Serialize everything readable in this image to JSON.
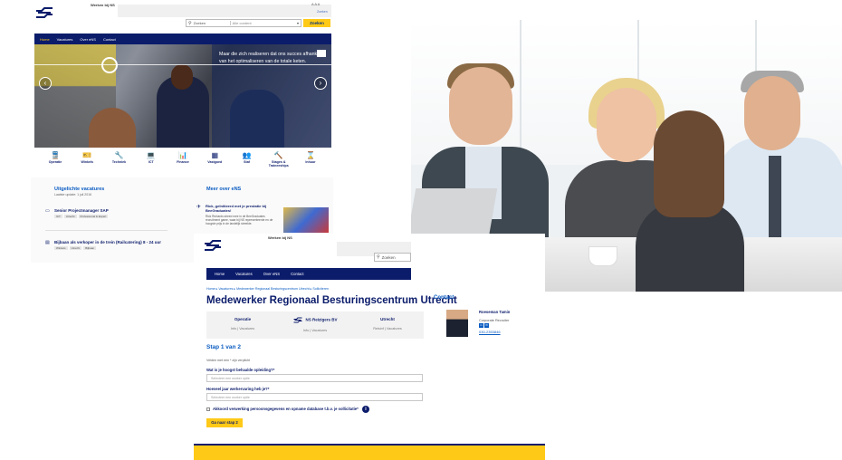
{
  "shot1": {
    "header": {
      "werken_bij": "Werken bij NS",
      "font_sizes": "A A A",
      "zoeken_link": "Zoeken"
    },
    "search": {
      "placeholder": "Zoeken",
      "scope": "Alle content",
      "button": "Zoeken"
    },
    "nav": [
      "Home",
      "Vacatures",
      "Over eNS",
      "Contact"
    ],
    "hero": {
      "quote": "Maar die zich realiseren dat ons succes afhankt van het optimaliseren van de totale keten."
    },
    "categories": [
      {
        "icon": "train-icon",
        "glyph": "🚆",
        "label": "Operatie"
      },
      {
        "icon": "ticket-icon",
        "glyph": "🎫",
        "label": "Winkels"
      },
      {
        "icon": "wrench-icon",
        "glyph": "🔧",
        "label": "Techniek"
      },
      {
        "icon": "laptop-icon",
        "glyph": "💻",
        "label": "ICT"
      },
      {
        "icon": "chart-icon",
        "glyph": "📊",
        "label": "Finance"
      },
      {
        "icon": "boxes-icon",
        "glyph": "▦",
        "label": "Vastgoed"
      },
      {
        "icon": "people-icon",
        "glyph": "👥",
        "label": "Staf"
      },
      {
        "icon": "hammer-icon",
        "glyph": "🔨",
        "label": "Stages & Traineeships"
      },
      {
        "icon": "hourglass-icon",
        "glyph": "⌛",
        "label": "Inhuur"
      }
    ],
    "vacatures": {
      "title": "Uitgelichte vacatures",
      "date": "Laatste update: 1 juli 2016",
      "jobs": [
        {
          "title": "Senior Projectmanager SAP",
          "tags": [
            "ICT",
            "Utrecht",
            "Professional & Expert"
          ]
        },
        {
          "title": "Bijbaan als verkoper in de trein (Railcatering) 8 - 24 uur",
          "tags": [
            "Winkels",
            "Utrecht",
            "Bijbaan"
          ]
        }
      ]
    },
    "meer_over": {
      "title": "Meer over eNS",
      "news_title": "Rick, geïnitieerd met je prestatie bij BeeGraduates!",
      "news_body": "Rick Richards streed mee in de BeeGraduates recruitment game, waar bij NS representeerde en de hoogste prijs in de landelijk streekte."
    }
  },
  "shot2": {
    "werken_bij": "Werken bij NS",
    "search_placeholder": "Zoeken",
    "nav": [
      "Home",
      "Vacatures",
      "Over eNS",
      "Contact"
    ],
    "breadcrumb": "Home ▸ Vacatures ▸ Medewerker Regionaal Besturingscentrum Utrecht ▸ Solliciteren",
    "title": "Medewerker Regionaal Besturingscentrum Utrecht",
    "info": [
      {
        "head": "Operatie",
        "sub": "Info | Vacatures"
      },
      {
        "head": "NS Reizigers BV",
        "sub": "Info | Vacatures"
      },
      {
        "head": "Utrecht",
        "sub": "Reisinf | Vacatures"
      }
    ],
    "contact": {
      "title": "Contact",
      "name": "Roeseman Tamin",
      "role": "Corporate Recruiter",
      "phone": "030-2353846"
    },
    "form": {
      "step": "Stap 1 van 2",
      "required_note": "Velden met een * zijn verplicht",
      "q1": "Wat is je hoogst behaalde opleiding?*",
      "q1_placeholder": "Selecteer een worker optie",
      "q2": "Hoeveel jaar werkervaring heb je?*",
      "q2_placeholder": "Selecteer een worker optie",
      "consent": "Akkoord verwerking persoonsgegevens en opname database t.b.v. je sollicitatie*",
      "info_glyph": "i",
      "next_button": "Ga naar stap 2"
    }
  },
  "colors": {
    "ns_blue": "#0b1c6b",
    "ns_link": "#0b5cc2",
    "ns_yellow": "#ffc917"
  }
}
